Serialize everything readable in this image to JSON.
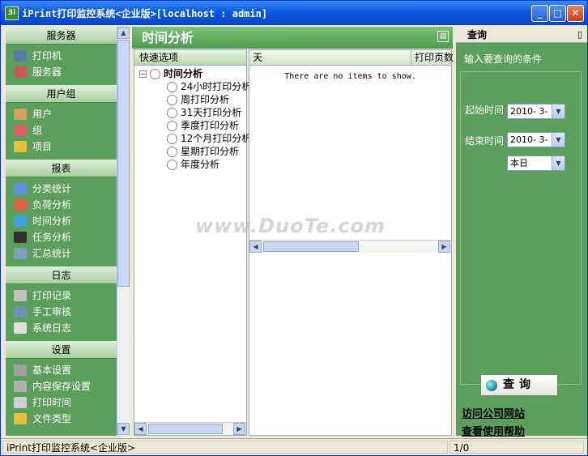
{
  "window": {
    "title": "iPrint打印监控系统<企业版>[localhost : admin]",
    "icon_text": "3i"
  },
  "left_nav": {
    "groups": [
      {
        "header": "服务器",
        "items": [
          {
            "label": "打印机",
            "icon": "printer-icon",
            "color": "#5a7aa8"
          },
          {
            "label": "服务器",
            "icon": "server-icon",
            "color": "#c85a5a"
          }
        ]
      },
      {
        "header": "用户组",
        "items": [
          {
            "label": "用户",
            "icon": "user-icon",
            "color": "#d8a060"
          },
          {
            "label": "组",
            "icon": "group-icon",
            "color": "#d86060"
          },
          {
            "label": "项目",
            "icon": "project-icon",
            "color": "#e8c040"
          }
        ]
      },
      {
        "header": "报表",
        "items": [
          {
            "label": "分类统计",
            "icon": "bar-chart-icon",
            "color": "#6090e0"
          },
          {
            "label": "负荷分析",
            "icon": "load-chart-icon",
            "color": "#e06040"
          },
          {
            "label": "时间分析",
            "icon": "time-chart-icon",
            "color": "#40a0e0"
          },
          {
            "label": "任务分析",
            "icon": "task-chart-icon",
            "color": "#303030"
          },
          {
            "label": "汇总统计",
            "icon": "summary-icon",
            "color": "#80a0c0"
          }
        ]
      },
      {
        "header": "日志",
        "items": [
          {
            "label": "打印记录",
            "icon": "print-log-icon",
            "color": "#c0c0c0"
          },
          {
            "label": "手工审核",
            "icon": "audit-icon",
            "color": "#7090b0"
          },
          {
            "label": "系统日志",
            "icon": "system-log-icon",
            "color": "#e0e0e0"
          }
        ]
      },
      {
        "header": "设置",
        "items": [
          {
            "label": "基本设置",
            "icon": "basic-settings-icon",
            "color": "#a0a0a0"
          },
          {
            "label": "内容保存设置",
            "icon": "content-settings-icon",
            "color": "#b0b0b0"
          },
          {
            "label": "打印时间",
            "icon": "clock-icon",
            "color": "#d0d0d0"
          },
          {
            "label": "文件类型",
            "icon": "file-type-icon",
            "color": "#e8c040"
          }
        ]
      }
    ]
  },
  "panel": {
    "title": "时间分析"
  },
  "tree": {
    "header": "快速选项",
    "root": "时间分析",
    "items": [
      "24小时打印分析",
      "周打印分析",
      "31天打印分析",
      "季度打印分析",
      "12个月打印分析",
      "星期打印分析",
      "年度分析"
    ]
  },
  "list": {
    "columns": [
      "天",
      "打印页数"
    ],
    "empty_message": "There are no items to show."
  },
  "query_panel": {
    "title": "查询",
    "pin": "📌",
    "prompt": "输入要查询的条件",
    "start_label": "起始时间",
    "start_value": "2010- 3-",
    "end_label": "结束时间",
    "end_value": "2010- 3-",
    "period_value": "本日",
    "query_button": "查询",
    "link_company": "访问公司网站",
    "link_help": "查看使用帮助"
  },
  "status": {
    "left": "iPrint打印监控系统<企业版>",
    "right": "1/0"
  },
  "watermark": "www.DuoTe.com"
}
